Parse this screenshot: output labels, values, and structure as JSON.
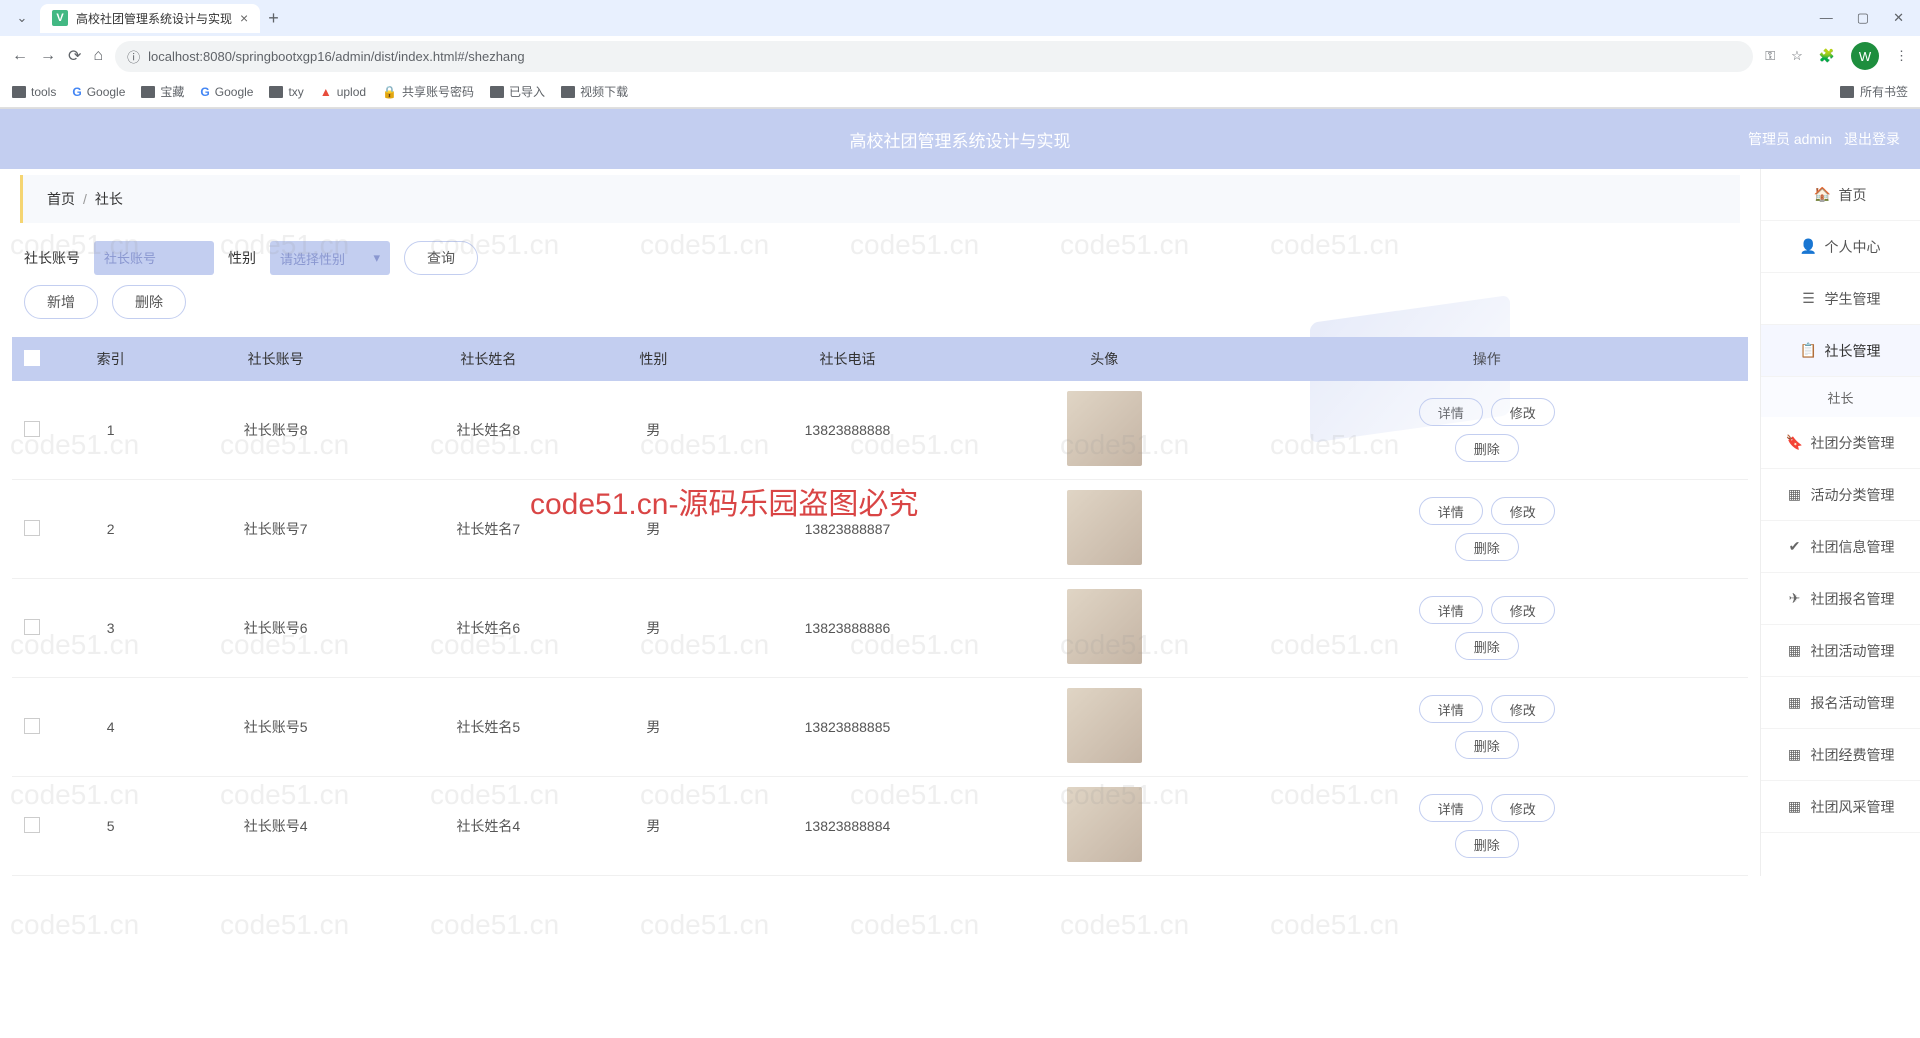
{
  "browser": {
    "tab_title": "高校社团管理系统设计与实现",
    "url": "localhost:8080/springbootxgp16/admin/dist/index.html#/shezhang",
    "avatar_letter": "W",
    "all_bookmarks": "所有书签",
    "bookmarks": [
      {
        "icon": "folder",
        "label": "tools"
      },
      {
        "icon": "g",
        "label": "Google"
      },
      {
        "icon": "folder",
        "label": "宝藏"
      },
      {
        "icon": "g",
        "label": "Google"
      },
      {
        "icon": "folder",
        "label": "txy"
      },
      {
        "icon": "up",
        "label": "uplod"
      },
      {
        "icon": "lock",
        "label": "共享账号密码"
      },
      {
        "icon": "folder",
        "label": "已导入"
      },
      {
        "icon": "folder",
        "label": "视频下载"
      }
    ]
  },
  "app": {
    "title": "高校社团管理系统设计与实现",
    "user_label": "管理员 admin",
    "logout": "退出登录"
  },
  "breadcrumb": {
    "home": "首页",
    "current": "社长"
  },
  "filters": {
    "account_label": "社长账号",
    "account_placeholder": "社长账号",
    "gender_label": "性别",
    "gender_placeholder": "请选择性别",
    "query_btn": "查询"
  },
  "actions": {
    "add": "新增",
    "delete": "删除"
  },
  "table": {
    "headers": [
      "索引",
      "社长账号",
      "社长姓名",
      "性别",
      "社长电话",
      "头像",
      "操作"
    ],
    "row_actions": {
      "detail": "详情",
      "edit": "修改",
      "delete": "删除"
    },
    "rows": [
      {
        "idx": "1",
        "account": "社长账号8",
        "name": "社长姓名8",
        "gender": "男",
        "phone": "13823888888"
      },
      {
        "idx": "2",
        "account": "社长账号7",
        "name": "社长姓名7",
        "gender": "男",
        "phone": "13823888887"
      },
      {
        "idx": "3",
        "account": "社长账号6",
        "name": "社长姓名6",
        "gender": "男",
        "phone": "13823888886"
      },
      {
        "idx": "4",
        "account": "社长账号5",
        "name": "社长姓名5",
        "gender": "男",
        "phone": "13823888885"
      },
      {
        "idx": "5",
        "account": "社长账号4",
        "name": "社长姓名4",
        "gender": "男",
        "phone": "13823888884"
      }
    ]
  },
  "sidebar": {
    "items": [
      {
        "icon": "🏠",
        "label": "首页"
      },
      {
        "icon": "👤",
        "label": "个人中心"
      },
      {
        "icon": "☰",
        "label": "学生管理"
      },
      {
        "icon": "📋",
        "label": "社长管理"
      },
      {
        "icon": "",
        "label": "社长",
        "sub": true
      },
      {
        "icon": "🔖",
        "label": "社团分类管理"
      },
      {
        "icon": "▦",
        "label": "活动分类管理"
      },
      {
        "icon": "✔",
        "label": "社团信息管理"
      },
      {
        "icon": "✈",
        "label": "社团报名管理"
      },
      {
        "icon": "▦",
        "label": "社团活动管理"
      },
      {
        "icon": "▦",
        "label": "报名活动管理"
      },
      {
        "icon": "▦",
        "label": "社团经费管理"
      },
      {
        "icon": "▦",
        "label": "社团风采管理"
      }
    ]
  },
  "watermark_red": "code51.cn-源码乐园盗图必究",
  "watermark_gray": "code51.cn"
}
